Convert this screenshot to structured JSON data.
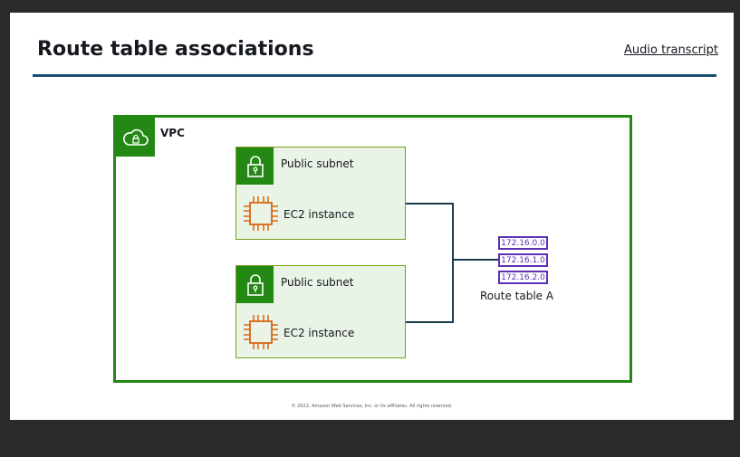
{
  "slide": {
    "title": "Route table associations",
    "transcript_link": "Audio transcript",
    "footer": "© 2022, Amazon Web Services, Inc. or its affiliates. All rights reserved."
  },
  "diagram": {
    "vpc": {
      "label": "VPC",
      "icon": "vpc-cloud-lock-icon"
    },
    "subnets": [
      {
        "label": "Public subnet",
        "instance": "EC2 instance"
      },
      {
        "label": "Public subnet",
        "instance": "EC2 instance"
      }
    ],
    "route_table": {
      "label": "Route table A",
      "entries": [
        "172.16.0.0",
        "172.16.1.0",
        "172.16.2.0"
      ]
    }
  },
  "colors": {
    "vpc_green": "#248814",
    "subnet_fill": "#e9f3e6",
    "ec2_orange": "#d86613",
    "route_purple": "#5a30b5",
    "connector": "#1b3a4f",
    "title_rule": "#1b4f72"
  }
}
